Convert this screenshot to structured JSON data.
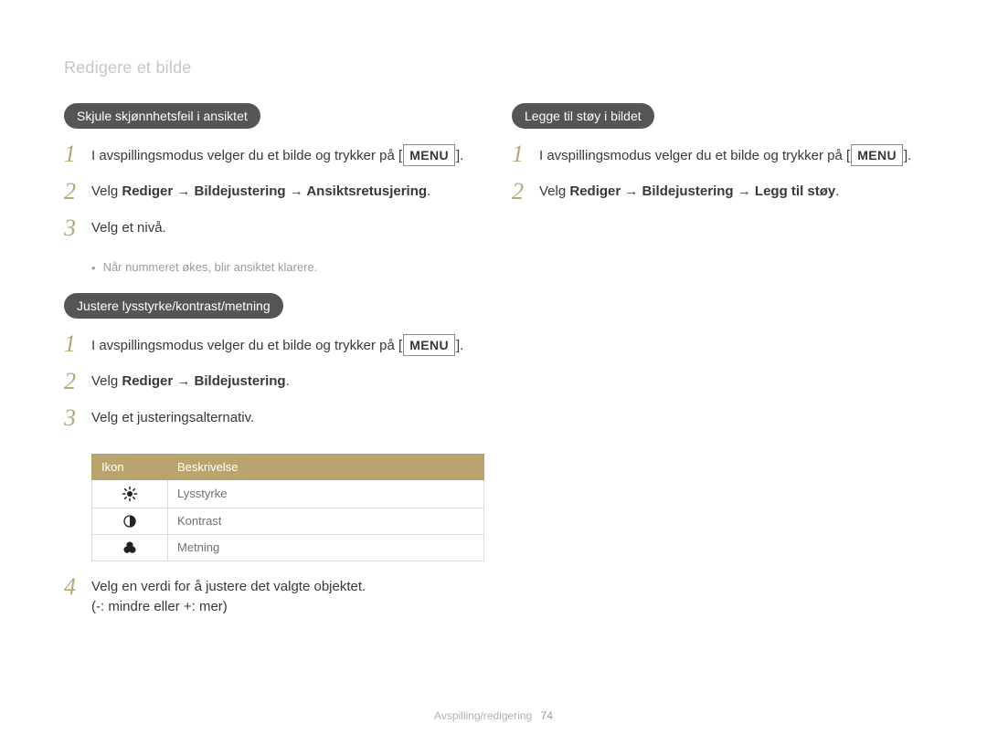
{
  "heading": "Redigere et bilde",
  "labels": {
    "menuBox": "MENU",
    "velg": "Velg",
    "arrow": "→"
  },
  "left": {
    "section1": {
      "pill": "Skjule skjønnhetsfeil i ansiktet",
      "steps": [
        {
          "n": "1",
          "text": "I avspillingsmodus velger du et bilde og trykker på",
          "trailingMenu": true
        },
        {
          "n": "2",
          "prefix": "Velg ",
          "bold": "Rediger → Bildejustering → Ansiktsretusjering",
          "suffix": "."
        },
        {
          "n": "3",
          "text": "Velg et nivå."
        }
      ],
      "note": "Når nummeret økes, blir ansiktet klarere."
    },
    "section2": {
      "pill": "Justere lysstyrke/kontrast/metning",
      "steps": [
        {
          "n": "1",
          "text": "I avspillingsmodus velger du et bilde og trykker på",
          "trailingMenu": true
        },
        {
          "n": "2",
          "prefix": "Velg ",
          "bold": "Rediger → Bildejustering",
          "suffix": "."
        },
        {
          "n": "3",
          "text": "Velg et justeringsalternativ."
        }
      ],
      "table": {
        "headers": [
          "Ikon",
          "Beskrivelse"
        ],
        "rows": [
          {
            "icon": "brightness",
            "label": "Lysstyrke"
          },
          {
            "icon": "contrast",
            "label": "Kontrast"
          },
          {
            "icon": "saturation",
            "label": "Metning"
          }
        ]
      },
      "step4": {
        "n": "4",
        "line1": "Velg en verdi for å justere det valgte objektet.",
        "line2": "(-: mindre eller +: mer)"
      }
    }
  },
  "right": {
    "section1": {
      "pill": "Legge til støy i bildet",
      "steps": [
        {
          "n": "1",
          "text": "I avspillingsmodus velger du et bilde og trykker på",
          "trailingMenu": true
        },
        {
          "n": "2",
          "prefix": "Velg ",
          "bold": "Rediger → Bildejustering → Legg til støy",
          "suffix": "."
        }
      ]
    }
  },
  "footer": {
    "label": "Avspilling/redigering",
    "page": "74"
  }
}
